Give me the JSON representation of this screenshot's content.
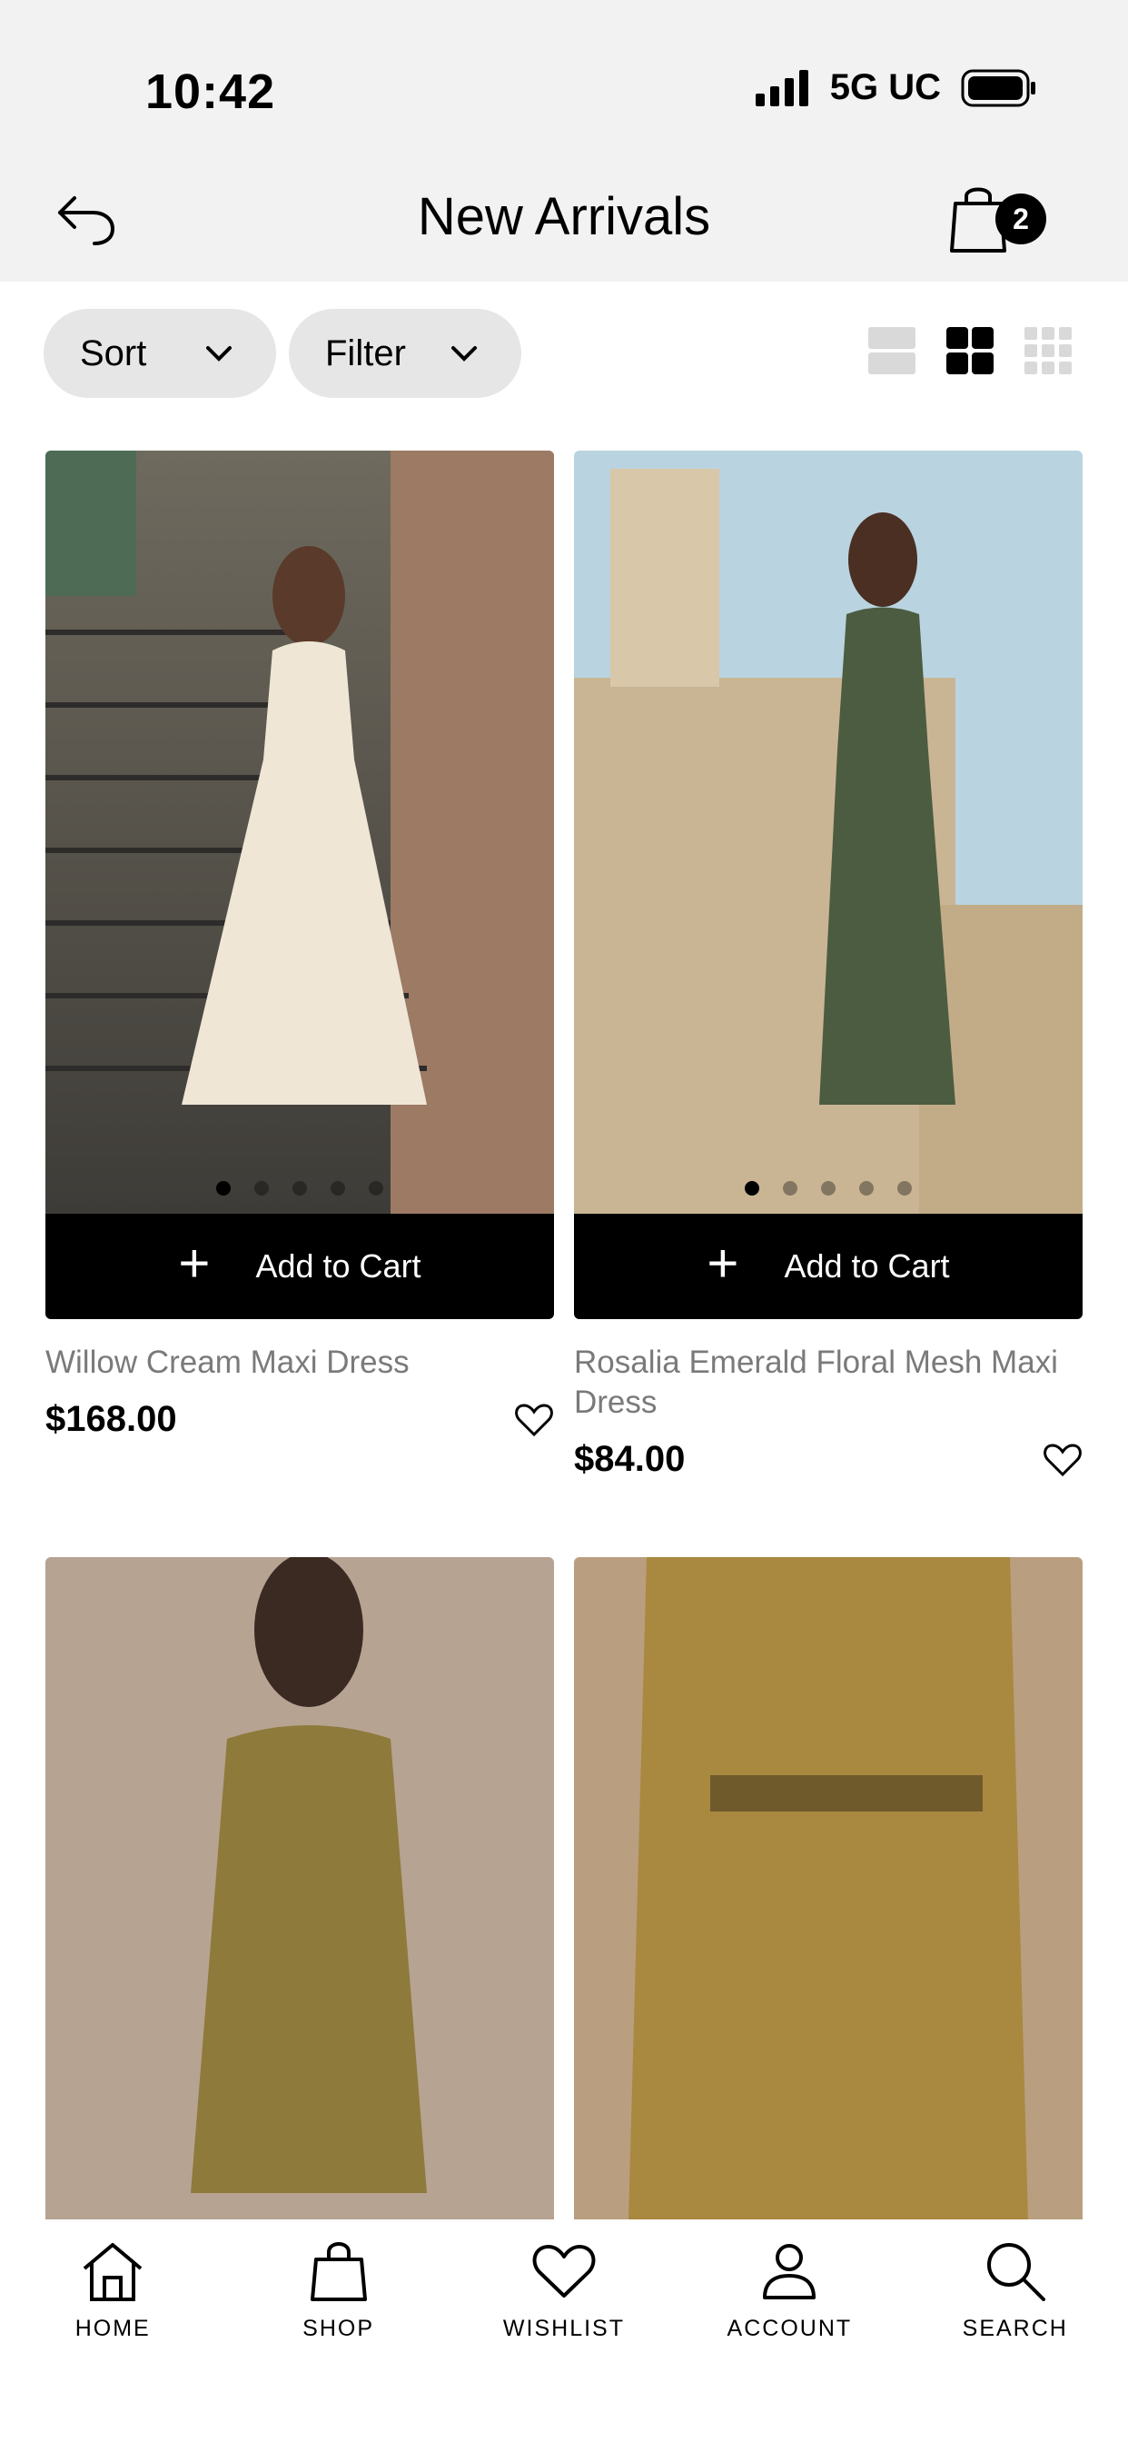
{
  "status_bar": {
    "time": "10:42",
    "network": "5G UC"
  },
  "header": {
    "title": "New Arrivals",
    "cart_count": "2"
  },
  "toolbar": {
    "sort_label": "Sort",
    "filter_label": "Filter"
  },
  "products": [
    {
      "name": "Willow Cream Maxi Dress",
      "price": "$168.00",
      "add_to_cart": "Add to Cart"
    },
    {
      "name": "Rosalia Emerald Floral Mesh Maxi Dress",
      "price": "$84.00",
      "add_to_cart": "Add to Cart"
    }
  ],
  "bottom_nav": [
    {
      "label": "HOME",
      "icon": "home-icon"
    },
    {
      "label": "SHOP",
      "icon": "shopping-bag-icon"
    },
    {
      "label": "WISHLIST",
      "icon": "heart-icon"
    },
    {
      "label": "ACCOUNT",
      "icon": "person-icon"
    },
    {
      "label": "SEARCH",
      "icon": "search-icon"
    }
  ],
  "colors": {
    "header_bg": "#f2f2f2",
    "pill_bg": "#e6e6e6",
    "button_bg": "#000000",
    "muted_text": "#7a7a7a"
  }
}
